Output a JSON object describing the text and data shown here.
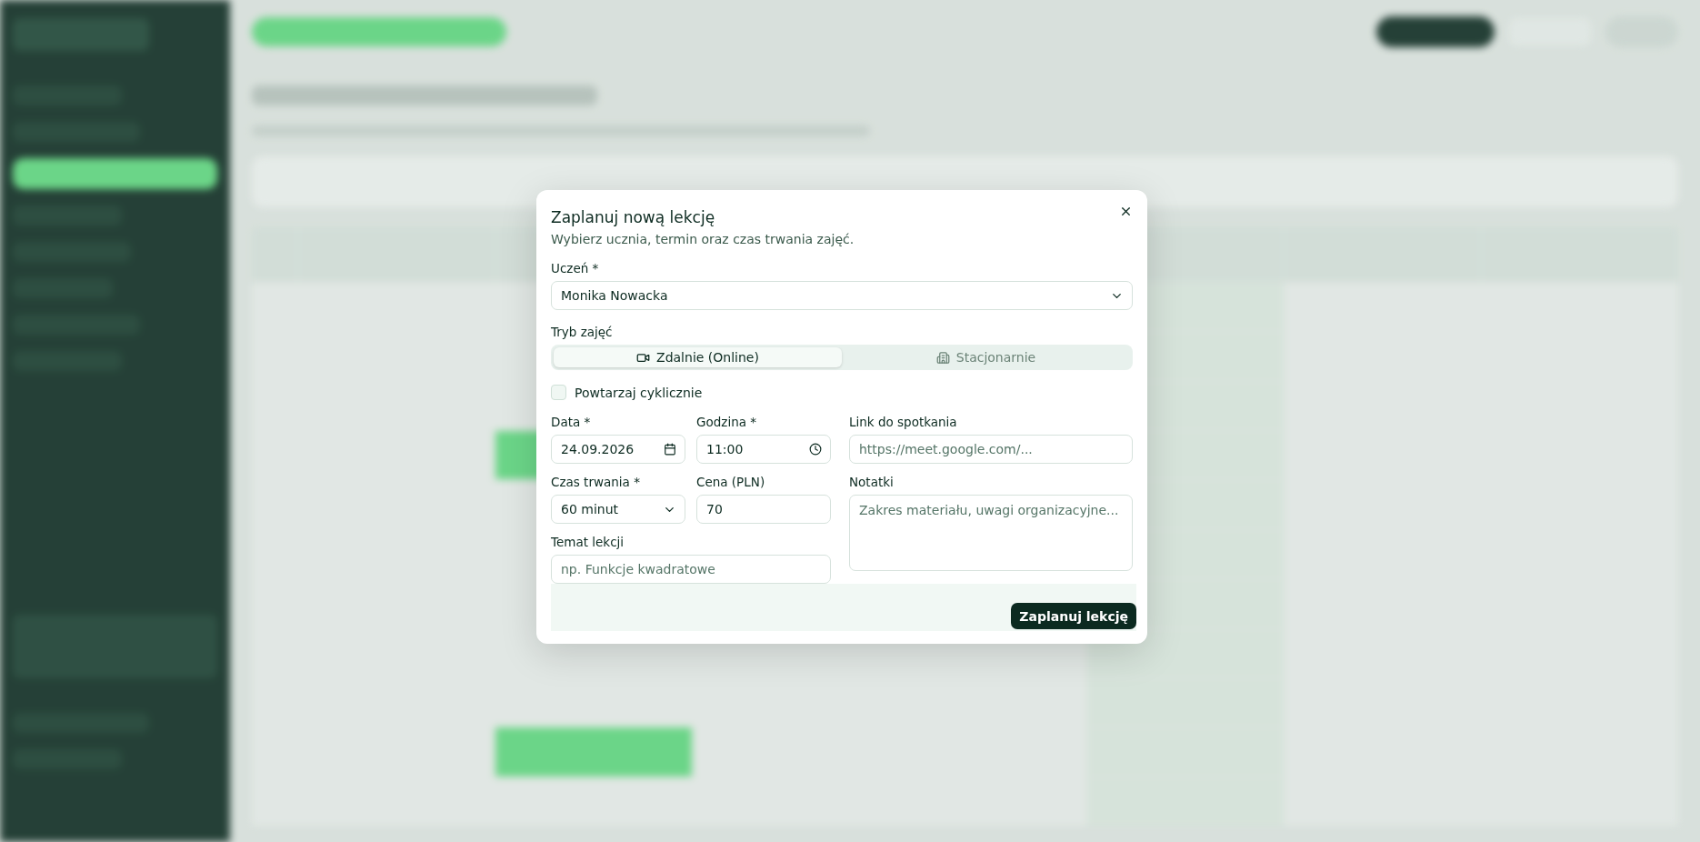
{
  "dialog": {
    "title": "Zaplanuj nową lekcję",
    "subtitle": "Wybierz ucznia, termin oraz czas trwania zajęć."
  },
  "student": {
    "label": "Uczeń *",
    "value": "Monika Nowacka"
  },
  "mode": {
    "label": "Tryb zajęć",
    "options": [
      {
        "label": "Zdalnie (Online)",
        "kind": "video",
        "selected": true
      },
      {
        "label": "Stacjonarnie",
        "kind": "building",
        "selected": false
      }
    ]
  },
  "recurring": {
    "label": "Powtarzaj cyklicznie",
    "checked": false
  },
  "date": {
    "label": "Data *",
    "value": "24.09.2026"
  },
  "time": {
    "label": "Godzina *",
    "value": "11:00"
  },
  "meeting_link": {
    "label": "Link do spotkania",
    "placeholder": "https://meet.google.com/..."
  },
  "duration": {
    "label": "Czas trwania *",
    "value": "60 minut"
  },
  "price": {
    "label": "Cena (PLN)",
    "value": "70"
  },
  "notes": {
    "label": "Notatki",
    "placeholder": "Zakres materiału, uwagi organizacyjne..."
  },
  "topic": {
    "label": "Temat lekcji",
    "placeholder": "np. Funkcje kwadratowe"
  },
  "submit": "Zaplanuj lekcję"
}
